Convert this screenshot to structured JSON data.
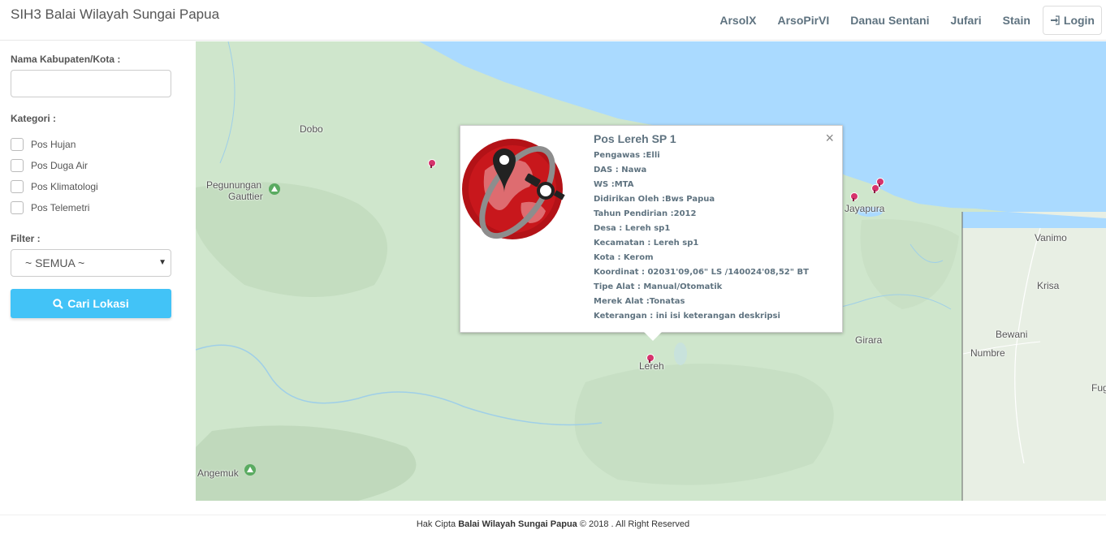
{
  "app": {
    "title": "SIH3 Balai Wilayah Sungai Papua"
  },
  "nav": {
    "items": [
      "ArsolX",
      "ArsoPirVI",
      "Danau Sentani",
      "Jufari",
      "Stain"
    ],
    "login_label": "Login",
    "login_icon": "sign-in-icon"
  },
  "sidebar": {
    "kabupaten_label": "Nama Kabupaten/Kota :",
    "kabupaten_value": "",
    "kategori_label": "Kategori :",
    "kategori": [
      "Pos Hujan",
      "Pos Duga Air",
      "Pos Klimatologi",
      "Pos Telemetri"
    ],
    "filter_label": "Filter :",
    "filter_value": "~ SEMUA ~",
    "search_button": "Cari Lokasi",
    "search_icon": "search-icon"
  },
  "map": {
    "places": {
      "dobo": "Dobo",
      "pegunungan": "Pegunungan",
      "gauttier": "Gauttier",
      "jayapura": "Jayapura",
      "vanimo": "Vanimo",
      "krisa": "Krisa",
      "bewani": "Bewani",
      "numbre": "Numbre",
      "girara": "Girara",
      "lereh": "Lereh",
      "angemuk": "Angemuk",
      "fug": "Fug"
    },
    "colors": {
      "land": "#cfe6cc",
      "water": "#aadaff",
      "marker": "#d6336c"
    }
  },
  "popup": {
    "title": "Pos Lereh SP 1",
    "close": "×",
    "lines": [
      "Pengawas :Elli",
      "DAS : Nawa",
      "WS :MTA",
      "Didirikan Oleh :Bws Papua",
      "Tahun Pendirian :2012",
      "Desa : Lereh sp1",
      "Kecamatan : Lereh sp1",
      "Kota : Kerom",
      "Koordinat : 02031'09,06\" LS /140024'08,52\" BT",
      "Tipe Alat : Manual/Otomatik",
      "Merek Alat :Tonatas",
      "Keterangan : ini isi keterangan deskripsi"
    ]
  },
  "footer": {
    "prefix": "Hak Cipta",
    "org": "Balai Wilayah Sungai Papua",
    "suffix": "© 2018 . All Right Reserved"
  }
}
